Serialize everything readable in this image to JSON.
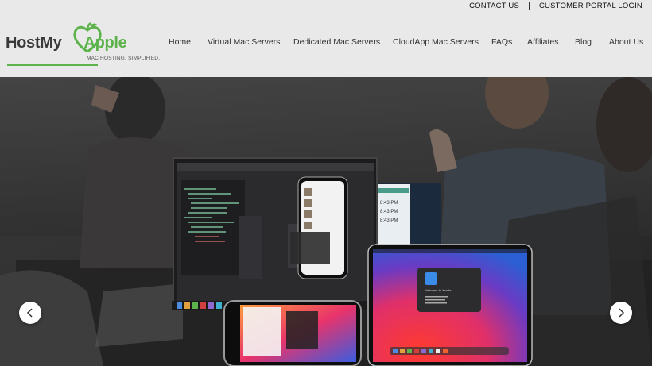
{
  "topbar": {
    "contact_label": "CONTACT US",
    "portal_label": "CUSTOMER PORTAL LOGIN"
  },
  "logo": {
    "name_part1": "HostMy",
    "name_part2": "Apple",
    "tagline": "MAC HOSTING, SIMPLIFIED."
  },
  "nav": {
    "items": [
      {
        "label": "Home"
      },
      {
        "label": "Virtual Mac Servers"
      },
      {
        "label": "Dedicated Mac Servers"
      },
      {
        "label": "CloudApp Mac Servers"
      },
      {
        "label": "FAQs"
      },
      {
        "label": "Affiliates"
      },
      {
        "label": "Blog"
      },
      {
        "label": "About Us"
      }
    ]
  },
  "hero": {
    "sidebar_times": [
      "8:43 PM",
      "8:43 PM",
      "8:43 PM"
    ],
    "xcode_welcome": "Welcome to Xcode"
  },
  "colors": {
    "brand_green": "#5db34b",
    "header_bg": "#e9e9e9"
  },
  "icons": {
    "prev": "chevron-left-icon",
    "next": "chevron-right-icon",
    "logo": "apple-heart-icon"
  }
}
